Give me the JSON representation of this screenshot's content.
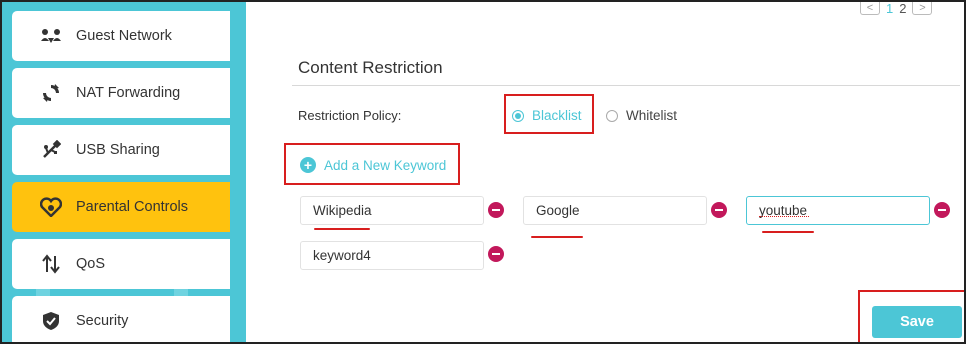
{
  "pager": {
    "prev": "<",
    "page1": "1",
    "page2": "2",
    "next": ">"
  },
  "sidebar": {
    "items": [
      {
        "label": "Guest Network",
        "icon": "guest-network-icon"
      },
      {
        "label": "NAT Forwarding",
        "icon": "nat-forwarding-icon"
      },
      {
        "label": "USB Sharing",
        "icon": "usb-icon"
      },
      {
        "label": "Parental Controls",
        "icon": "heart-icon",
        "active": true
      },
      {
        "label": "QoS",
        "icon": "up-down-arrows-icon"
      },
      {
        "label": "Security",
        "icon": "shield-icon"
      }
    ]
  },
  "content": {
    "title": "Content Restriction",
    "policy_label": "Restriction Policy:",
    "policy_options": [
      "Blacklist",
      "Whitelist"
    ],
    "selected_policy": "Blacklist",
    "add_keyword_label": "Add a New Keyword",
    "keywords": [
      "Wikipedia",
      "Google",
      "youtube",
      "keyword4"
    ],
    "save_label": "Save"
  },
  "colors": {
    "accent": "#4cc6d6",
    "active_nav": "#ffc20e",
    "remove": "#c2185b",
    "annotation": "#d81e1e"
  }
}
